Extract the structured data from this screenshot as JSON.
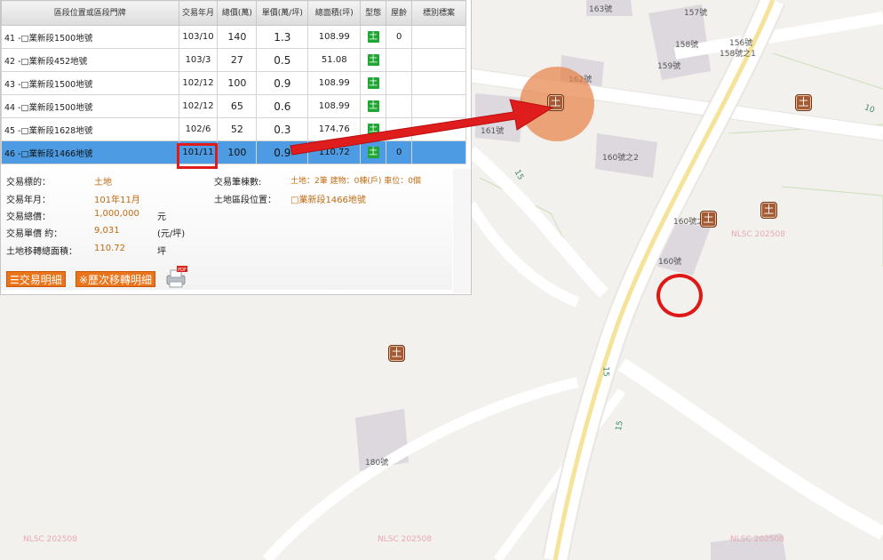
{
  "map": {
    "labels": [
      "163號",
      "157號",
      "158號",
      "156號",
      "158號之1",
      "159號",
      "162號",
      "161號",
      "160號之2",
      "160號之",
      "160號",
      "180號"
    ],
    "road_numbers": [
      "10",
      "15",
      "15",
      "15"
    ],
    "watermarks": [
      "NLSC 202508",
      "NLSC 202508",
      "NLSC 202508",
      "NLSC 202508"
    ],
    "marker_glyph": "土"
  },
  "table": {
    "headers": [
      "區段位置或區段門牌",
      "交易年月",
      "總價(萬)",
      "單價(萬/坪)",
      "總面積(坪)",
      "型態",
      "屋齡",
      "標別標案"
    ],
    "rows": [
      {
        "no": "41",
        "addr": "-□業新段1500地號",
        "date": "103/10",
        "total": "140",
        "unit": "1.3",
        "area": "108.99",
        "type": "土",
        "age": "0",
        "mark": ""
      },
      {
        "no": "42",
        "addr": "-□業新段452地號",
        "date": "103/3",
        "total": "27",
        "unit": "0.5",
        "area": "51.08",
        "type": "土",
        "age": "",
        "mark": ""
      },
      {
        "no": "43",
        "addr": "-□業新段1500地號",
        "date": "102/12",
        "total": "100",
        "unit": "0.9",
        "area": "108.99",
        "type": "土",
        "age": "",
        "mark": ""
      },
      {
        "no": "44",
        "addr": "-□業新段1500地號",
        "date": "102/12",
        "total": "65",
        "unit": "0.6",
        "area": "108.99",
        "type": "土",
        "age": "",
        "mark": ""
      },
      {
        "no": "45",
        "addr": "-□業新段1628地號",
        "date": "102/6",
        "total": "52",
        "unit": "0.3",
        "area": "174.76",
        "type": "土",
        "age": "",
        "mark": ""
      },
      {
        "no": "46",
        "addr": "-□業新段1466地號",
        "date": "101/11",
        "total": "100",
        "unit": "0.9",
        "area": "110.72",
        "type": "土",
        "age": "0",
        "mark": ""
      }
    ]
  },
  "detail": {
    "target_label": "交易標的：",
    "target_value": "土地",
    "date_label": "交易年月：",
    "date_value": "101年11月",
    "total_label": "交易總價：",
    "total_value": "1,000,000",
    "total_unit": "元",
    "unit_label": "交易單價 約：",
    "unit_value": "9,031",
    "unit_unit": "(元/坪)",
    "area_label": "土地移轉總面積：",
    "area_value": "110.72",
    "area_unit": "坪",
    "count_label": "交易筆棟數:",
    "count_value": "土地：2筆 建物：0棟(戶) 車位：0個",
    "location_label": "土地區段位置：",
    "location_value": "□業新段1466地號",
    "btn_detail": "交易明細",
    "btn_history": "※歷次移轉明細",
    "pdf_badge": "PDF"
  }
}
